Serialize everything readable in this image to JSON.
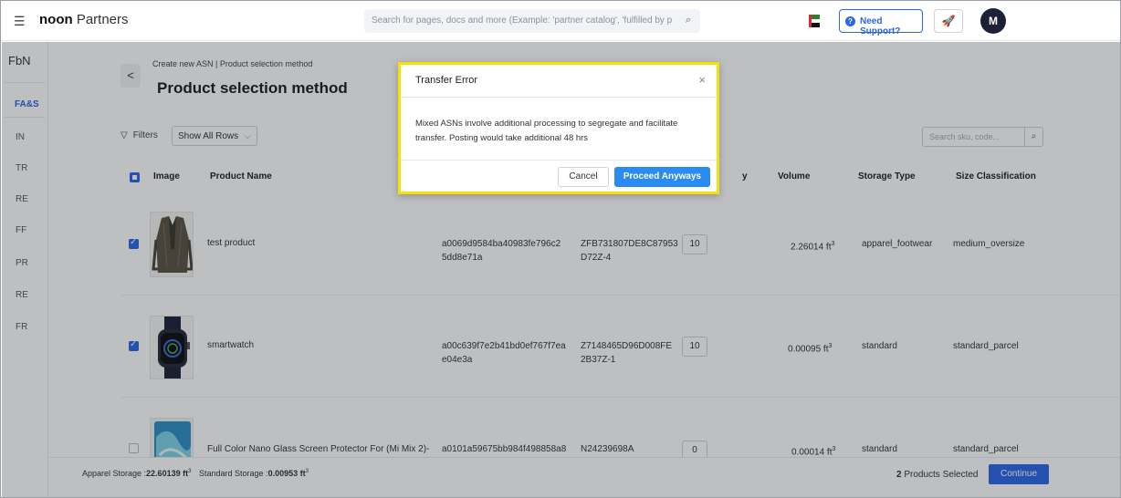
{
  "topbar": {
    "menu_icon": "hamburger-icon",
    "brand_bold": "noon",
    "brand_rest": " Partners",
    "search_placeholder": "Search for pages, docs and more (Example: 'partner catalog', 'fulfilled by p",
    "search_icon": "search-icon",
    "support_label": "Need Support?",
    "rocket_icon": "rocket-icon",
    "avatar_initial": "M"
  },
  "sidebar": {
    "title": "FbN",
    "items": [
      {
        "label": "FA&S",
        "active": true
      },
      {
        "label": "IN"
      },
      {
        "label": "TR"
      },
      {
        "label": "RE"
      },
      {
        "label": "FF"
      },
      {
        "label": "PR"
      },
      {
        "label": "RE"
      },
      {
        "label": "FR"
      }
    ]
  },
  "page": {
    "back_glyph": "<",
    "breadcrumb": "Create new ASN |  Product selection method",
    "title": "Product selection method",
    "filters_label": "Filters",
    "rows_select": "Show All Rows",
    "search_placeholder": "Search sku, code..."
  },
  "table": {
    "headers": {
      "image": "Image",
      "product_name": "Product Name",
      "qty_tail": "y",
      "volume": "Volume",
      "storage_type": "Storage Type",
      "size_class": "Size Classification"
    },
    "rows": [
      {
        "name": "test product",
        "code1": "a0069d9584ba40983fe796c2",
        "code1b": "5dd8e71a",
        "code2": "ZFB731807DE8C87953",
        "code2b": "D72Z-4",
        "qty": "10",
        "volume": "2.26014 ft",
        "volume_exp": "3",
        "storage": "apparel_footwear",
        "size": "medium_oversize",
        "checked": true
      },
      {
        "name": "smartwatch",
        "code1": "a00c639f7e2b41bd0ef767f7ea",
        "code1b": "e04e3a",
        "code2": "Z7148465D96D008FE",
        "code2b": "2B37Z-1",
        "qty": "10",
        "volume": "0.00095 ft",
        "volume_exp": "3",
        "storage": "standard",
        "size": "standard_parcel",
        "checked": true
      },
      {
        "name": "Full Color Nano Glass Screen Protector For (Mi Mix 2)-",
        "code1": "a0101a59675bb984f498858a8",
        "code2": "N24239698A",
        "qty": "0",
        "volume": "0.00014 ft",
        "volume_exp": "3",
        "storage": "standard",
        "size": "standard_parcel",
        "checked": false
      }
    ]
  },
  "footer": {
    "apparel_label": "Apparel Storage :",
    "apparel_value": "22.60139 ft",
    "standard_label": "Standard Storage :",
    "standard_value": "0.00953 ft",
    "exp": "3",
    "selected_count": "2",
    "selected_label": " Products Selected",
    "continue_label": "Continue"
  },
  "modal": {
    "title": "Transfer Error",
    "close_glyph": "×",
    "body": "Mixed ASNs involve additional processing to segregate and facilitate transfer. Posting would take additional 48 hrs",
    "cancel_label": "Cancel",
    "proceed_label": "Proceed Anyways",
    "highlight_color": "#f2e20a"
  },
  "colors": {
    "accent": "#2a66e8",
    "proceed": "#2a8cf0",
    "avatar_bg": "#1b2238"
  }
}
